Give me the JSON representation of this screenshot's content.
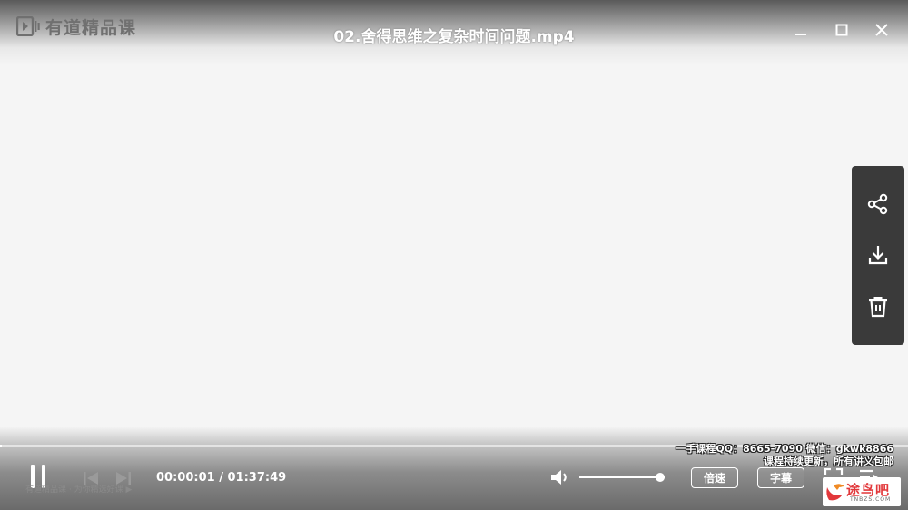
{
  "app": {
    "brand": "有道精品课",
    "title": "02.舍得思维之复杂时间问题.mp4"
  },
  "window_controls": {
    "minimize": "minimize-icon",
    "maximize": "maximize-icon",
    "close": "close-icon"
  },
  "side_panel": {
    "items": [
      "share-icon",
      "download-icon",
      "trash-icon"
    ]
  },
  "player": {
    "current_time": "00:00:01",
    "separator": "/",
    "duration": "01:37:49",
    "progress_fraction": 0.0002,
    "volume_fraction": 0.95,
    "faint_caption": "有道精品课 · 为你精选好课 ▶",
    "speed_label": "倍速",
    "subtitle_label": "字幕"
  },
  "watermark": {
    "line1": "一手课程QQ：8665-7090 微信：gkwk8866",
    "line2": "课程持续更新，所有讲义包邮"
  },
  "site_logo": {
    "name": "途鸟吧",
    "domain": "TNBZS.COM"
  },
  "colors": {
    "panel_bg": "#3a3a3a",
    "control_fg": "#ffffff",
    "logo_red": "#e2383b"
  }
}
